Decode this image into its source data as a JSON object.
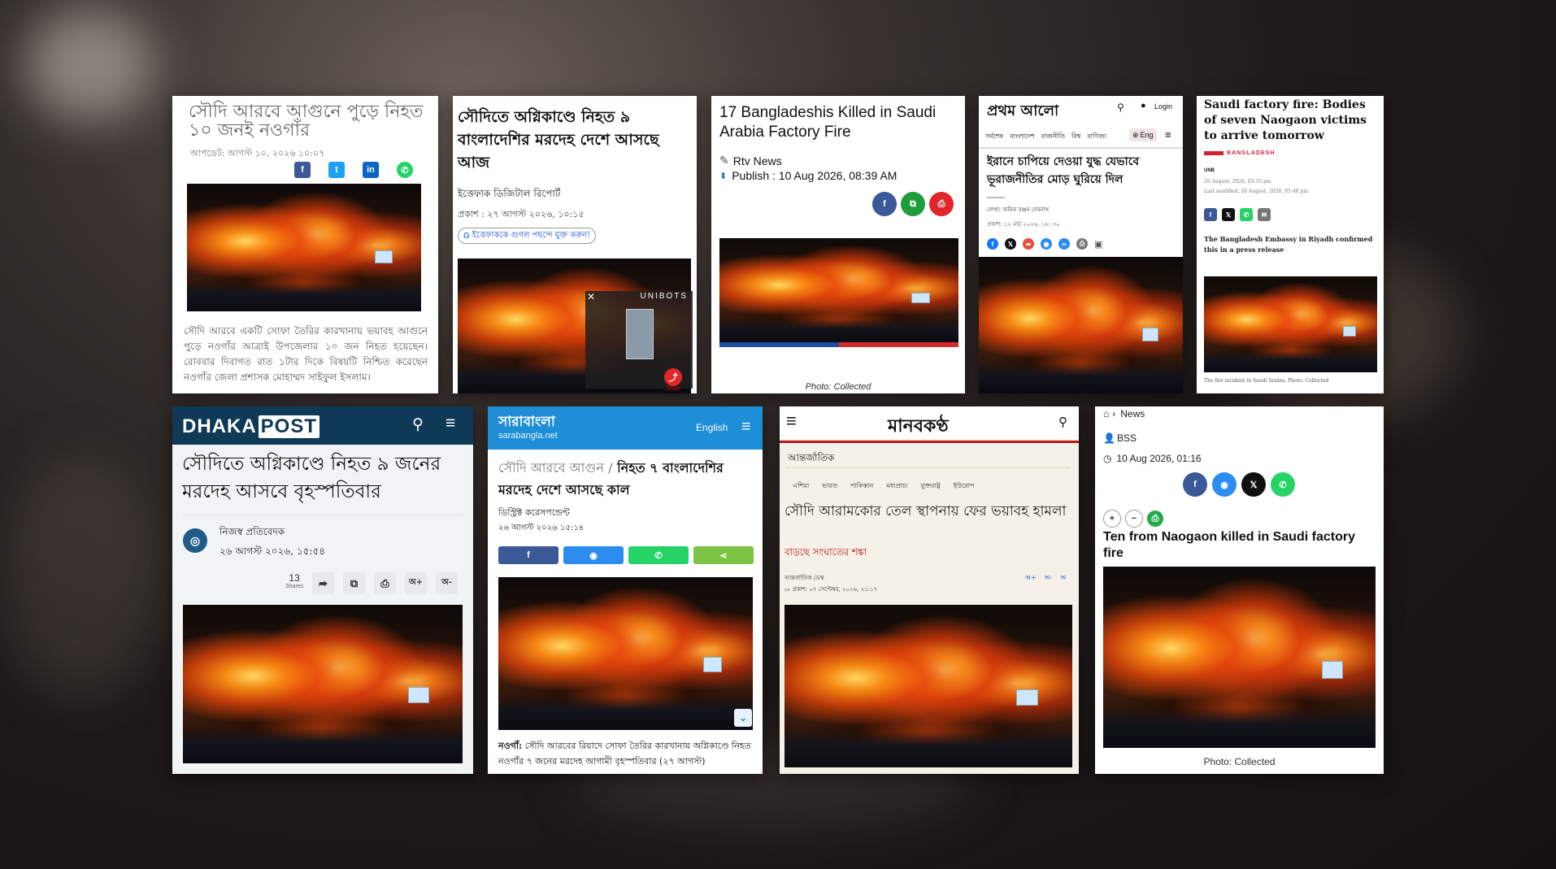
{
  "card1": {
    "headline": "সৌদি আরবে আগুনে পুড়ে নিহত ১০ জনই নওগাঁর",
    "updated": "আপডেট: আগস্ট ১০, ২০২৬ ১০:০৭",
    "body": "সৌদি আরবে একটি সোফা তৈরির কারখানায় ভয়াবহ আগুনে পুড়ে নওগাঁর আত্রাই উপজেলার ১০ জন নিহত হয়েছেন। রোববার দিবাগত রাত ১টার দিকে বিষয়টি নিশ্চিত করেছেন নওগাঁর জেলা প্রশাসক মোহাম্মদ সাইফুল ইসলাম।",
    "share": [
      "f",
      "t",
      "in",
      "w"
    ]
  },
  "card2": {
    "headline": "সৌদিতে অগ্নিকাণ্ডে নিহত ৯ বাংলাদেশির মরদেহ দেশে আসছে আজ",
    "byline": "ইত্তেফাক ডিজিটাল রিপোর্ট",
    "published": "প্রকাশ : ২৭ আগস্ট ২০২৬, ১০:১৫",
    "google_pill": "ইত্তেফাককে গুগল পছন্দে যুক্ত করুন!",
    "ad_label": "UNIBOTS",
    "share_label": "Share"
  },
  "card3": {
    "headline": "17 Bangladeshis Killed in Saudi Arabia Factory Fire",
    "author": "Rtv News",
    "publish": "Publish : 10 Aug 2026, 08:39 AM",
    "caption": "Photo: Collected"
  },
  "card4": {
    "logo": "প্রথম আলো",
    "login": "Login",
    "nav": [
      "সর্বশেষ",
      "বাংলাদেশ",
      "রাজনীতি",
      "বিশ্ব",
      "বাণিজ্য"
    ],
    "eng": "Eng",
    "headline": "ইরানে চাপিয়ে দেওয়া যুদ্ধ যেভাবে ভূরাজনীতির মোড় ঘুরিয়ে দিল",
    "author": "লেখা: অমিত রঞ্জন দেবনাথ",
    "published": "প্রকাশ: ১২ মার্চ ২০২৬, ১৮: ৩০"
  },
  "card5": {
    "headline": "Saudi factory fire: Bodies of seven Naogaon victims to arrive tomorrow",
    "section": "BANGLADESH",
    "agency": "UNB",
    "date1": "26 August, 2026, 03:35 pm",
    "date2": "Last modified: 26 August, 2026, 05:40 pm",
    "lede": "The Bangladesh Embassy in Riyadh confirmed this in a press release",
    "caption": "The fire incident in Saudi Arabia. Photo: Collected"
  },
  "card6": {
    "logo_left": "DHAKA",
    "logo_right": "POST",
    "headline": "সৌদিতে অগ্নিকাণ্ডে নিহত ৯ জনের মরদেহ আসবে বৃহস্পতিবার",
    "author": "নিজস্ব প্রতিবেদক",
    "date": "২৬ আগস্ট ২০২৬, ১৫:৫৪",
    "shares_count": "13",
    "shares_label": "Shares",
    "font_plus": "অ+",
    "font_minus": "অ-"
  },
  "card7": {
    "logo": "সারাবাংলা",
    "logo_sub": "sarabangla.net",
    "lang": "English",
    "kicker": "সৌদি আরবে আগুন /",
    "headline": "নিহত ৭ বাংলাদেশির মরদেহ দেশে আসছে কাল",
    "byline": "ডিস্ট্রিক্ট করেসপন্ডেন্ট",
    "date": "২৬ আগস্ট ২০২৬ ১৫:১৪",
    "body_lead": "নওগাঁ:",
    "body": "সৌদি আরবের রিয়াদে সোফা তৈরির কারখানায় অগ্নিকাণ্ডে নিহত নওগাঁর ৭ জনের মরদেহ আগামী বৃহস্পতিবার (২৭ আগস্ট)"
  },
  "card8": {
    "logo": "মানবকণ্ঠ",
    "section": "আন্তর্জাতিক",
    "subnav": [
      "এশিয়া",
      "ভারত",
      "পাকিস্তান",
      "মধ্যপ্রাচ্য",
      "যুক্তরাষ্ট্র",
      "ইউরোপ"
    ],
    "headline": "সৌদি আরামকোর তেল স্থাপনায় ফের ভয়াবহ হামলা",
    "subhead": "বাড়ছে সংঘাতের শঙ্কা",
    "desk": "আন্তর্জাতিক ডেস্ক",
    "published": "প্রকাশ: ০৭ সেপ্টেম্বর, ২০২৬, ২১:১৭",
    "font_controls": [
      "অ+",
      "অ-",
      "অ"
    ]
  },
  "card9": {
    "breadcrumb": "News",
    "author": "BSS",
    "date": "10 Aug 2026, 01:16",
    "headline": "Ten from Naogaon killed in Saudi factory fire",
    "caption": "Photo: Collected"
  },
  "colors": {
    "facebook": "#3b5998",
    "twitter": "#1da1f2",
    "whatsapp": "#25d366",
    "dhakapost": "#0f3a57",
    "sarabangla": "#1e8ed6",
    "manobkantha_red": "#b8161b",
    "tbs_red": "#d5202f"
  }
}
